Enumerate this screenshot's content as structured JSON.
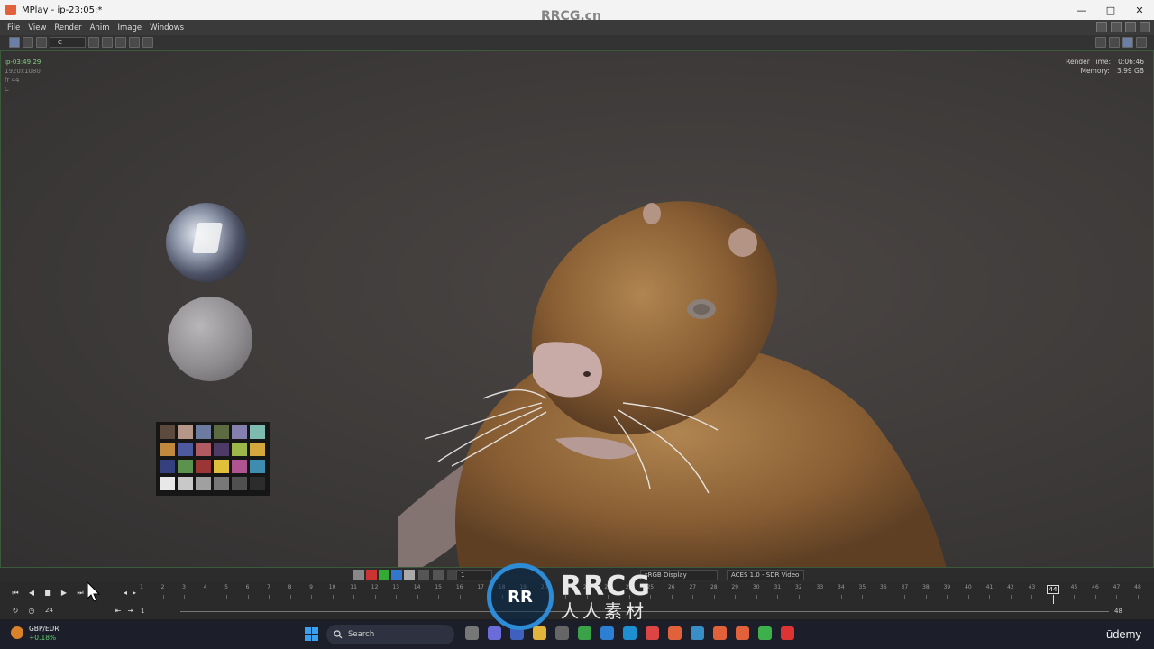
{
  "window": {
    "title": "MPlay - ip-23:05:*",
    "controls": [
      "—",
      "□",
      "✕"
    ]
  },
  "menu": [
    "File",
    "View",
    "Render",
    "Anim",
    "Image",
    "Windows"
  ],
  "toolbar": {
    "channel": "C"
  },
  "viewport": {
    "render_name": "ip-03:49:29",
    "resolution": "1920x1080",
    "frame": "fr 44",
    "plane": "C",
    "render_time_label": "Render Time:",
    "render_time_value": "0:06:46",
    "memory_label": "Memory:",
    "memory_value": "3.99 GB"
  },
  "color_bar": {
    "exposure_value": "1",
    "display_value": "sRGB   Display",
    "view_value": "ACES 1.0 - SDR Video"
  },
  "timeline": {
    "current_frame": "44",
    "tick_labels": [
      "1",
      "2",
      "3",
      "4",
      "5",
      "6",
      "7",
      "8",
      "9",
      "10",
      "11",
      "12",
      "13",
      "14",
      "15",
      "16",
      "17",
      "18",
      "19",
      "20",
      "21",
      "22",
      "23",
      "24",
      "25",
      "26",
      "27",
      "28",
      "29",
      "30",
      "31",
      "32",
      "33",
      "34",
      "35",
      "36",
      "37",
      "38",
      "39",
      "40",
      "41",
      "42",
      "43",
      "44",
      "45",
      "46",
      "47",
      "48"
    ]
  },
  "range": {
    "fps": "24",
    "start": "1",
    "end": "48"
  },
  "taskbar": {
    "weather_title": "GBP/EUR",
    "weather_value": "+0.18%",
    "search_label": "Search",
    "brand": "ūdemy"
  },
  "watermarks": {
    "top": "RRCG.cn",
    "logo_text": "RRCG",
    "logo_cn": "人人素材",
    "logo_mark": "RR"
  },
  "macbeth_colors": [
    "#5c4a3f",
    "#b59787",
    "#6b7ca0",
    "#5d6b43",
    "#8481b0",
    "#7dbbb0",
    "#c1893e",
    "#4e5a9f",
    "#b05a63",
    "#4e3a66",
    "#9eb74a",
    "#d5a63c",
    "#35407f",
    "#5b924d",
    "#9c3535",
    "#e0c03a",
    "#b05491",
    "#3f8cb1",
    "#e8e8e8",
    "#c8c8c8",
    "#a0a0a0",
    "#787878",
    "#505050",
    "#2c2c2c"
  ],
  "colors": {
    "accent_green": "#7fd17f",
    "udemy_text": "#f0f0f0"
  }
}
